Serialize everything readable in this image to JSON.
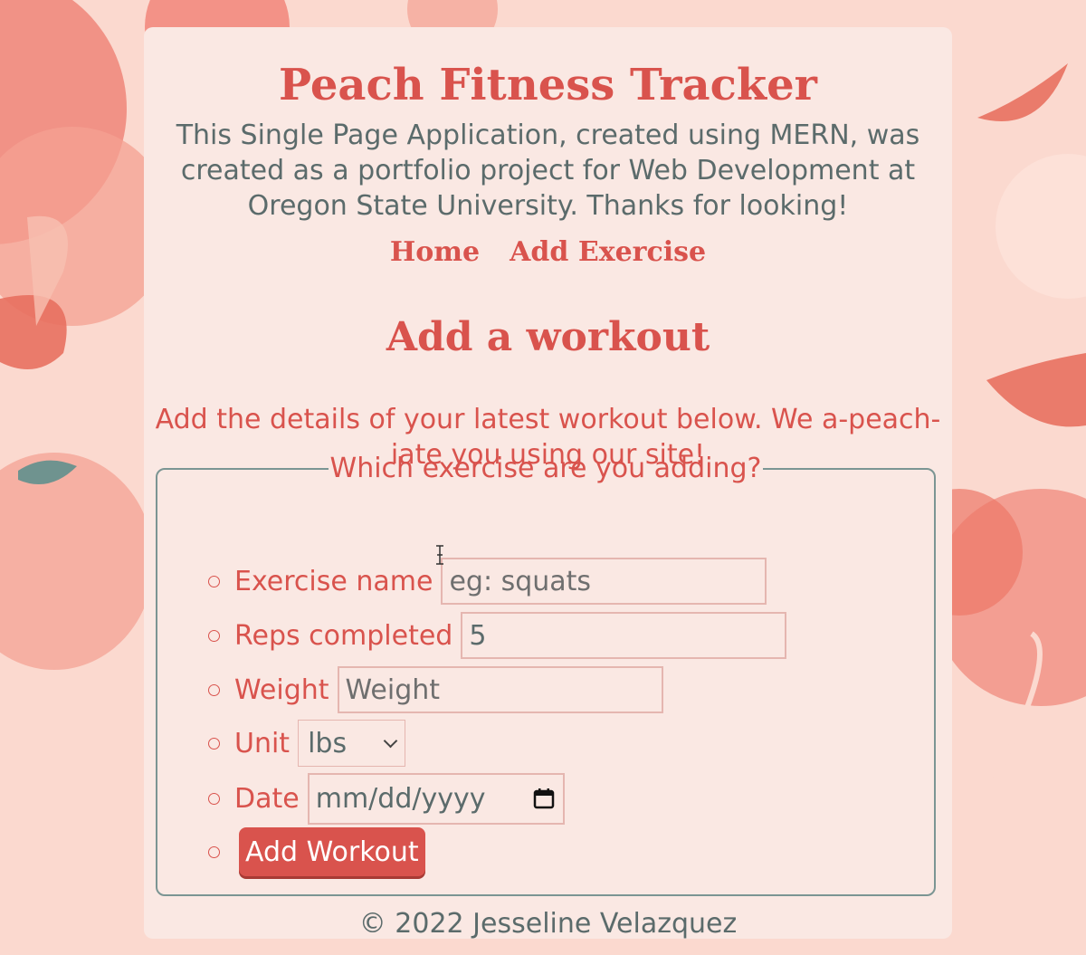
{
  "header": {
    "title": "Peach Fitness Tracker",
    "intro": "This Single Page Application, created using MERN, was created as a portfolio project for Web Development at Oregon State University. Thanks for looking!"
  },
  "nav": {
    "home": "Home",
    "add_exercise": "Add Exercise"
  },
  "main": {
    "heading": "Add a workout",
    "lede": "Add the details of your latest workout below. We a-peach-iate you using our site!",
    "legend": "Which exercise are you adding?"
  },
  "form": {
    "name_label": "Exercise name",
    "name_placeholder": "eg: squats",
    "reps_label": "Reps completed",
    "reps_value": "5",
    "weight_label": "Weight",
    "weight_placeholder": "Weight",
    "unit_label": "Unit",
    "unit_value": "lbs",
    "date_label": "Date",
    "date_placeholder": "mm/dd/yyyy",
    "submit_label": "Add Workout"
  },
  "footer": {
    "text": "© 2022 Jesseline Velazquez"
  },
  "colors": {
    "accent": "#d9534d",
    "text": "#5b6b6b",
    "card": "#fae8e3",
    "border": "#7b9593",
    "background": "#fbd9cf"
  },
  "icons": [
    "calendar-icon",
    "chevron-down-icon",
    "text-cursor-icon"
  ]
}
